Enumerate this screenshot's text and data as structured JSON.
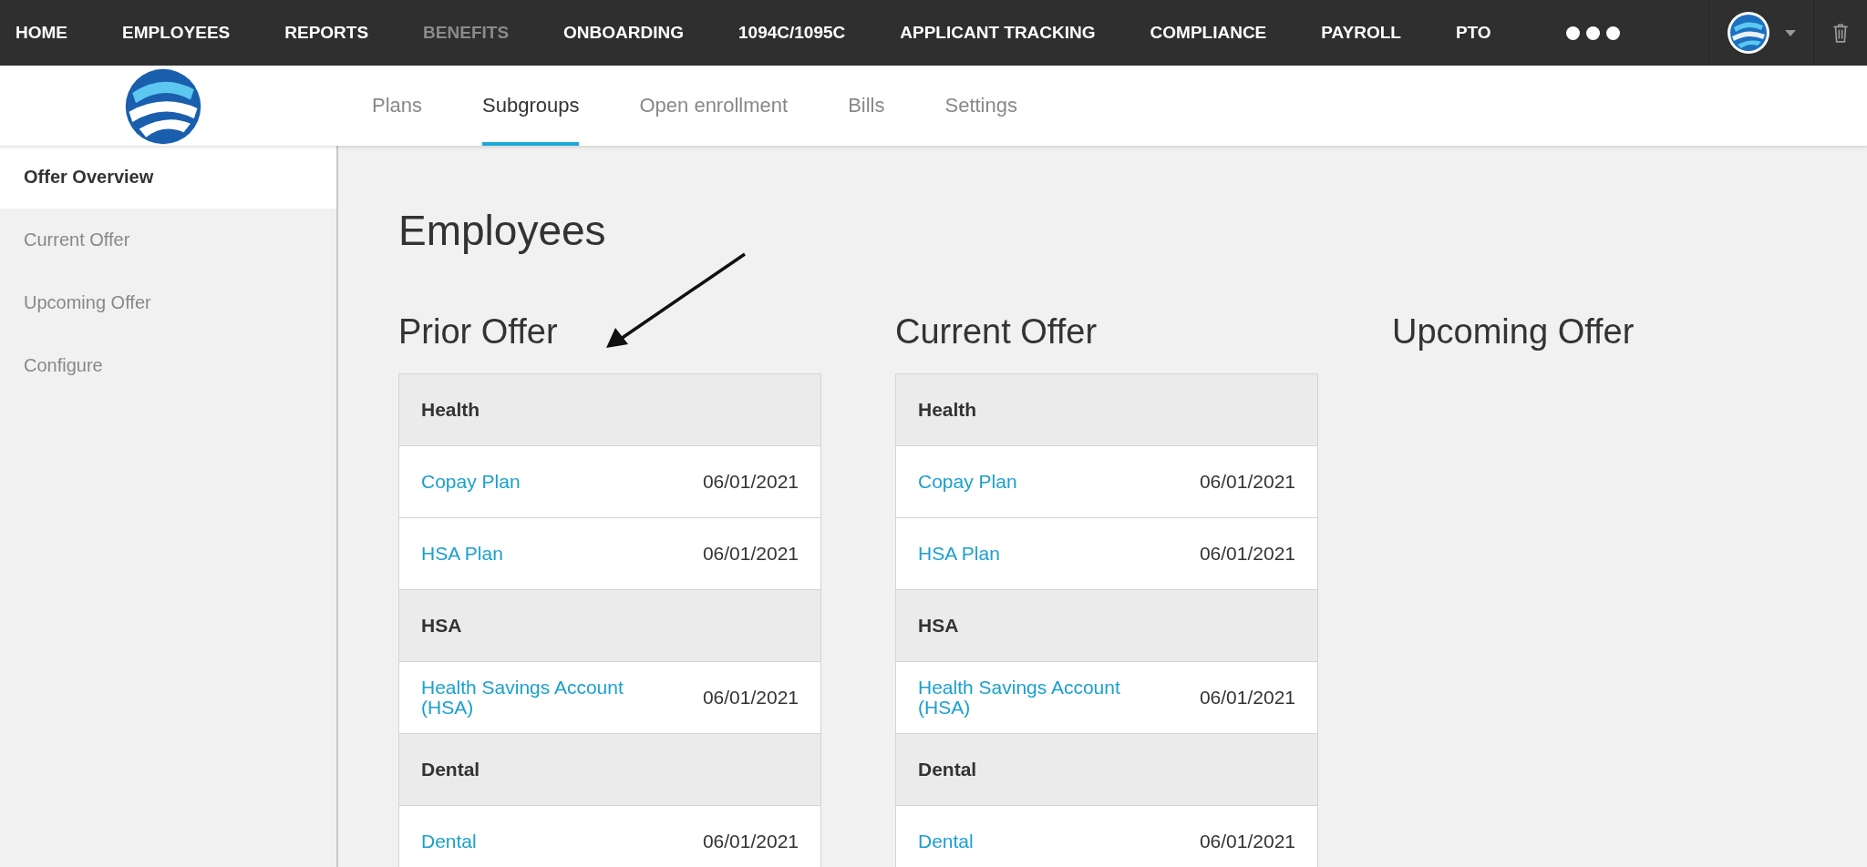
{
  "top_nav": {
    "items": [
      {
        "label": "HOME",
        "selected": false
      },
      {
        "label": "EMPLOYEES",
        "selected": false
      },
      {
        "label": "REPORTS",
        "selected": false
      },
      {
        "label": "BENEFITS",
        "selected": true
      },
      {
        "label": "ONBOARDING",
        "selected": false
      },
      {
        "label": "1094C/1095C",
        "selected": false
      },
      {
        "label": "APPLICANT TRACKING",
        "selected": false
      },
      {
        "label": "COMPLIANCE",
        "selected": false
      },
      {
        "label": "PAYROLL",
        "selected": false
      },
      {
        "label": "PTO",
        "selected": false
      }
    ]
  },
  "tabs": [
    {
      "label": "Plans",
      "selected": false
    },
    {
      "label": "Subgroups",
      "selected": true
    },
    {
      "label": "Open enrollment",
      "selected": false
    },
    {
      "label": "Bills",
      "selected": false
    },
    {
      "label": "Settings",
      "selected": false
    }
  ],
  "sidebar": {
    "items": [
      {
        "label": "Offer Overview",
        "selected": true
      },
      {
        "label": "Current Offer",
        "selected": false
      },
      {
        "label": "Upcoming Offer",
        "selected": false
      },
      {
        "label": "Configure",
        "selected": false
      }
    ]
  },
  "page_title": "Employees",
  "offers": [
    {
      "title": "Prior Offer",
      "groups": [
        {
          "name": "Health",
          "plans": [
            {
              "name": "Copay Plan",
              "date": "06/01/2021"
            },
            {
              "name": "HSA Plan",
              "date": "06/01/2021"
            }
          ]
        },
        {
          "name": "HSA",
          "plans": [
            {
              "name": "Health Savings Account (HSA)",
              "date": "06/01/2021"
            }
          ]
        },
        {
          "name": "Dental",
          "plans": [
            {
              "name": "Dental",
              "date": "06/01/2021"
            }
          ]
        }
      ]
    },
    {
      "title": "Current Offer",
      "groups": [
        {
          "name": "Health",
          "plans": [
            {
              "name": "Copay Plan",
              "date": "06/01/2021"
            },
            {
              "name": "HSA Plan",
              "date": "06/01/2021"
            }
          ]
        },
        {
          "name": "HSA",
          "plans": [
            {
              "name": "Health Savings Account (HSA)",
              "date": "06/01/2021"
            }
          ]
        },
        {
          "name": "Dental",
          "plans": [
            {
              "name": "Dental",
              "date": "06/01/2021"
            }
          ]
        }
      ]
    },
    {
      "title": "Upcoming Offer"
    }
  ]
}
